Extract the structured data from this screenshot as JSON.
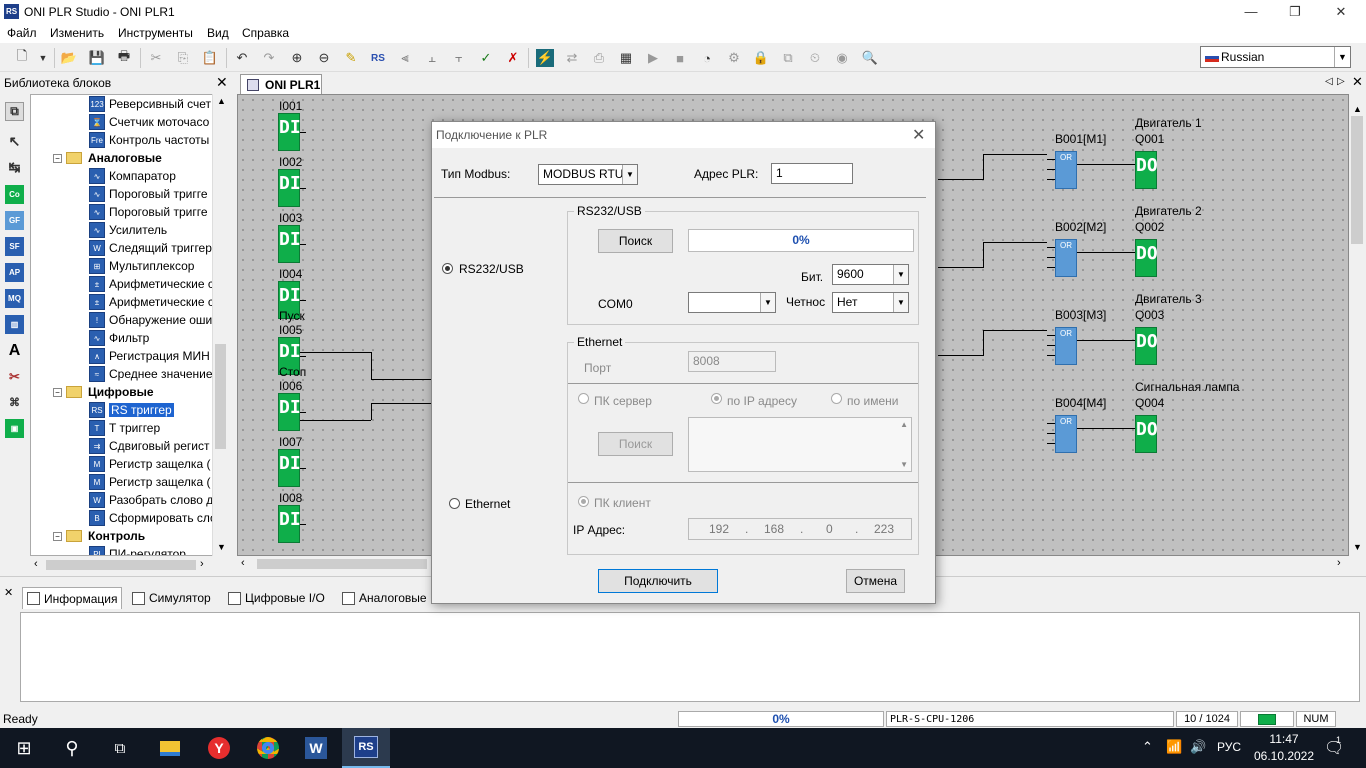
{
  "window": {
    "logo": "RS",
    "title": "ONI PLR Studio - ONI PLR1",
    "minimize": "—",
    "maximize": "❐",
    "close": "✕"
  },
  "menu": [
    "Файл",
    "Изменить",
    "Инструменты",
    "Вид",
    "Справка"
  ],
  "language": {
    "selected": "Russian"
  },
  "library": {
    "title": "Библиотека блоков",
    "items": [
      {
        "type": "item",
        "label": "Реверсивный счет",
        "icon": "123"
      },
      {
        "type": "item",
        "label": "Счетчик моточасо",
        "icon": "⌛"
      },
      {
        "type": "item",
        "label": "Контроль частоты",
        "icon": "Fre"
      },
      {
        "type": "folder",
        "label": "Аналоговые"
      },
      {
        "type": "item",
        "label": "Компаратор",
        "icon": "∿"
      },
      {
        "type": "item",
        "label": "Пороговый тригге",
        "icon": "∿"
      },
      {
        "type": "item",
        "label": "Пороговый тригге",
        "icon": "∿"
      },
      {
        "type": "item",
        "label": "Усилитель",
        "icon": "∿"
      },
      {
        "type": "item",
        "label": "Следящий триггер",
        "icon": "W"
      },
      {
        "type": "item",
        "label": "Мультиплексор",
        "icon": "⊞"
      },
      {
        "type": "item",
        "label": "Арифметические с",
        "icon": "±"
      },
      {
        "type": "item",
        "label": "Арифметические с",
        "icon": "±"
      },
      {
        "type": "item",
        "label": "Обнаружение оши",
        "icon": "!"
      },
      {
        "type": "item",
        "label": "Фильтр",
        "icon": "∿"
      },
      {
        "type": "item",
        "label": "Регистрация МИН",
        "icon": "∧"
      },
      {
        "type": "item",
        "label": "Среднее значение",
        "icon": "≈"
      },
      {
        "type": "folder",
        "label": "Цифровые"
      },
      {
        "type": "item",
        "label": "RS триггер",
        "icon": "RS",
        "selected": true
      },
      {
        "type": "item",
        "label": "T триггер",
        "icon": "T"
      },
      {
        "type": "item",
        "label": "Сдвиговый регист",
        "icon": "⇉"
      },
      {
        "type": "item",
        "label": "Регистр защелка (",
        "icon": "M"
      },
      {
        "type": "item",
        "label": "Регистр защелка (",
        "icon": "M"
      },
      {
        "type": "item",
        "label": "Разобрать слово д",
        "icon": "W"
      },
      {
        "type": "item",
        "label": "Сформировать сло",
        "icon": "B"
      },
      {
        "type": "folder",
        "label": "Контроль"
      },
      {
        "type": "item",
        "label": "ПИ-регулятор",
        "icon": "PI"
      }
    ]
  },
  "document_tab": "ONI PLR1",
  "diagram": {
    "inputs": [
      {
        "id": "I001",
        "name": ""
      },
      {
        "id": "I002",
        "name": ""
      },
      {
        "id": "I003",
        "name": ""
      },
      {
        "id": "I004",
        "name": ""
      },
      {
        "id": "I005",
        "name": "Пуск"
      },
      {
        "id": "I006",
        "name": "Стоп"
      },
      {
        "id": "I007",
        "name": ""
      },
      {
        "id": "I008",
        "name": ""
      }
    ],
    "or_blocks": [
      "B001[M1]",
      "B002[M2]",
      "B003[M3]",
      "B004[M4]"
    ],
    "outputs": [
      {
        "id": "Q001",
        "name": "Двигатель 1"
      },
      {
        "id": "Q002",
        "name": "Двигатель 2"
      },
      {
        "id": "Q003",
        "name": "Двигатель 3"
      },
      {
        "id": "Q004",
        "name": "Сигнальная лампа"
      }
    ],
    "di_text": "DI",
    "do_text": "DO",
    "or_text": "OR"
  },
  "dialog": {
    "title": "Подключение к PLR",
    "modbus_label": "Тип Modbus:",
    "modbus_value": "MODBUS RTU",
    "address_label": "Адрес PLR:",
    "address_value": "1",
    "rs232_radio": "RS232/USB",
    "ethernet_radio": "Ethernet",
    "rs232_group": {
      "legend": "RS232/USB",
      "search_button": "Поиск",
      "progress": "0%",
      "bit_label": "Бит.",
      "bit_value": "9600",
      "com_label": "COM0",
      "com_value": "",
      "parity_label": "Четнос",
      "parity_value": "Нет"
    },
    "ethernet_group": {
      "legend": "Ethernet",
      "port_label": "Порт",
      "port_value": "8008",
      "pc_server": "ПК сервер",
      "by_ip": "по IP адресу",
      "by_name": "по имени",
      "search_button": "Поиск",
      "pc_client": "ПК клиент",
      "ip_label": "IP Адрес:",
      "ip": [
        "192",
        "168",
        "0",
        "223"
      ]
    },
    "connect_button": "Подключить",
    "cancel_button": "Отмена"
  },
  "bottom_tabs": [
    "Информация",
    "Симулятор",
    "Цифровые I/O",
    "Аналоговые"
  ],
  "status": {
    "ready": "Ready",
    "progress": "0%",
    "device": "PLR-S-CPU-1206",
    "blocks": "10 / 1024",
    "num": "NUM"
  },
  "taskbar": {
    "ime": "РУС",
    "time": "11:47",
    "date": "06.10.2022",
    "notifications": "1"
  },
  "colors": {
    "di_green": "#0fae4a",
    "or_blue": "#5b9ad6",
    "selection": "#1e64d0"
  }
}
